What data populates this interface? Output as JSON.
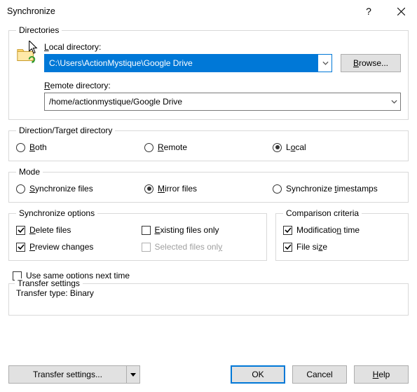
{
  "title": "Synchronize",
  "groups": {
    "directories": "Directories",
    "direction": "Direction/Target directory",
    "mode": "Mode",
    "sync_options": "Synchronize options",
    "comparison": "Comparison criteria",
    "transfer_settings": "Transfer settings"
  },
  "dirs": {
    "local_label_pre": "",
    "local_label_accel": "L",
    "local_label_post": "ocal directory:",
    "local_value": "C:\\Users\\ActionMystique\\Google Drive",
    "remote_label_pre": "",
    "remote_label_accel": "R",
    "remote_label_post": "emote directory:",
    "remote_value": "/home/actionmystique/Google Drive",
    "browse_pre": "",
    "browse_accel": "B",
    "browse_post": "rowse..."
  },
  "direction": {
    "both_accel": "B",
    "both_post": "oth",
    "remote_accel": "R",
    "remote_post": "emote",
    "local_pre": "L",
    "local_accel": "o",
    "local_post": "cal"
  },
  "mode": {
    "sync_pre": "",
    "sync_accel": "S",
    "sync_post": "ynchronize files",
    "mirror_accel": "M",
    "mirror_post": "irror files",
    "ts_pre": "Synchronize ",
    "ts_accel": "t",
    "ts_post": "imestamps"
  },
  "options": {
    "delete_accel": "D",
    "delete_post": "elete files",
    "existing_accel": "E",
    "existing_post": "xisting files only",
    "preview_accel": "P",
    "preview_post": "review changes",
    "selected_pre": "Selected files onl",
    "selected_accel": "y",
    "same_pre": "Use s",
    "same_accel": "a",
    "same_post": "me options next time"
  },
  "comparison": {
    "modtime_pre": "Modificatio",
    "modtime_accel": "n",
    "modtime_post": " time",
    "size_pre": "File si",
    "size_accel": "z",
    "size_post": "e"
  },
  "transfer": {
    "type_label": "Transfer type: Binary",
    "settings_btn_pre": "Transfer settin",
    "settings_btn_accel": "g",
    "settings_btn_post": "s..."
  },
  "footer": {
    "ok": "OK",
    "cancel": "Cancel",
    "help_accel": "H",
    "help_post": "elp"
  }
}
